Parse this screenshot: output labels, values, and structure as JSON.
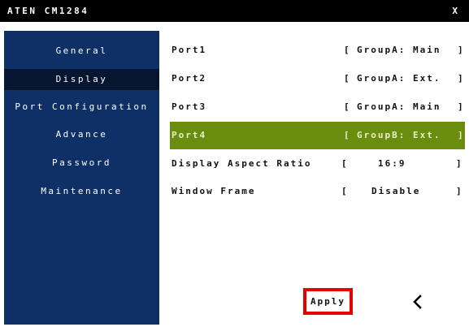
{
  "window": {
    "title": "ATEN CM1284",
    "close_label": "X"
  },
  "sidebar": {
    "items": [
      {
        "label": "General",
        "active": false
      },
      {
        "label": "Display",
        "active": true
      },
      {
        "label": "Port Configuration",
        "active": false
      },
      {
        "label": "Advance",
        "active": false
      },
      {
        "label": "Password",
        "active": false
      },
      {
        "label": "Maintenance",
        "active": false
      }
    ]
  },
  "settings": {
    "rows": [
      {
        "label": "Port1",
        "open": "[",
        "value": "GroupA: Main",
        "close": "]",
        "selected": false
      },
      {
        "label": "Port2",
        "open": "[",
        "value": "GroupA: Ext.",
        "close": "]",
        "selected": false
      },
      {
        "label": "Port3",
        "open": "[",
        "value": "GroupA: Main",
        "close": "]",
        "selected": false
      },
      {
        "label": "Port4",
        "open": "[",
        "value": "GroupB: Ext.",
        "close": "]",
        "selected": true
      },
      {
        "label": "Display Aspect Ratio",
        "open": "[",
        "value": "16:9",
        "close": "]",
        "selected": false
      },
      {
        "label": "Window Frame",
        "open": "[",
        "value": "Disable",
        "close": "]",
        "selected": false
      }
    ]
  },
  "footer": {
    "apply_label": "Apply",
    "back_icon": "chevron-left-icon"
  },
  "colors": {
    "sidebar": "#0e3066",
    "sidebar_active": "#061630",
    "selected_row": "#6a8c0f",
    "highlight_border": "#e60000"
  }
}
